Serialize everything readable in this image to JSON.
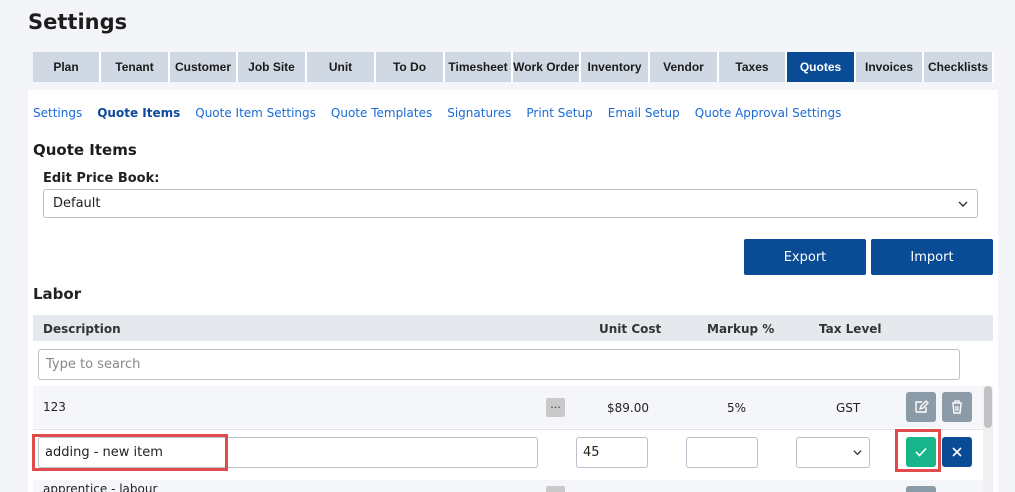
{
  "page": {
    "title": "Settings"
  },
  "tabs": [
    {
      "label": "Plan",
      "width": 68
    },
    {
      "label": "Tenant",
      "width": 69
    },
    {
      "label": "Customer",
      "width": 68
    },
    {
      "label": "Job Site",
      "width": 69
    },
    {
      "label": "Unit",
      "width": 69
    },
    {
      "label": "To Do",
      "width": 69
    },
    {
      "label": "Timesheet",
      "width": 68
    },
    {
      "label": "Work Order",
      "width": 68
    },
    {
      "label": "Inventory",
      "width": 69
    },
    {
      "label": "Vendor",
      "width": 69
    },
    {
      "label": "Taxes",
      "width": 68
    },
    {
      "label": "Quotes",
      "width": 69,
      "active": true
    },
    {
      "label": "Invoices",
      "width": 68
    },
    {
      "label": "Checklists",
      "width": 70
    }
  ],
  "subnav": [
    {
      "label": "Settings"
    },
    {
      "label": "Quote Items",
      "active": true
    },
    {
      "label": "Quote Item Settings"
    },
    {
      "label": "Quote Templates"
    },
    {
      "label": "Signatures"
    },
    {
      "label": "Print Setup"
    },
    {
      "label": "Email Setup"
    },
    {
      "label": "Quote Approval Settings"
    }
  ],
  "section": {
    "title": "Quote Items"
  },
  "price_book": {
    "label": "Edit Price Book:",
    "value": "Default"
  },
  "buttons": {
    "export": "Export",
    "import": "Import"
  },
  "labor": {
    "title": "Labor",
    "columns": {
      "description": "Description",
      "unit_cost": "Unit Cost",
      "markup": "Markup %",
      "tax_level": "Tax Level"
    },
    "search_placeholder": "Type to search",
    "rows": [
      {
        "description": "123",
        "unit_cost": "$89.00",
        "markup": "5%",
        "tax_level": "GST",
        "dots": "..."
      }
    ],
    "new_item": {
      "description": "adding  - new item",
      "unit_cost": "45",
      "markup": "",
      "tax_level": ""
    },
    "next_row_partial": "apprentice - labour"
  },
  "colors": {
    "accent": "#0a4b96",
    "confirm": "#18b48a",
    "highlight": "#e14b4b",
    "tab_bg": "#d0d9e3"
  }
}
